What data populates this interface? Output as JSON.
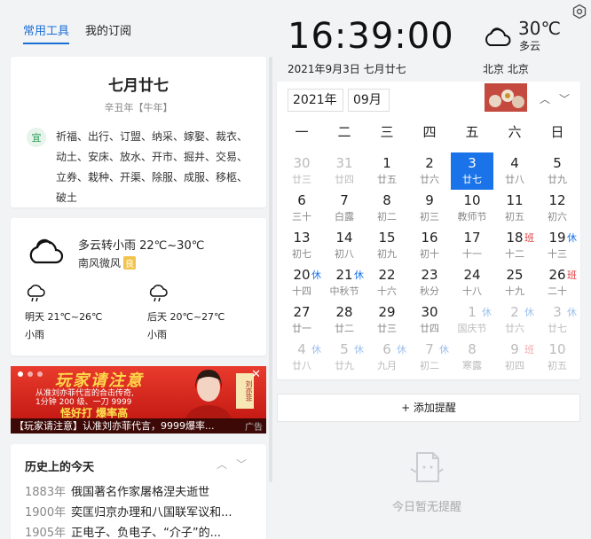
{
  "tabs": [
    {
      "label": "常用工具"
    },
    {
      "label": "我的订阅"
    }
  ],
  "almanac": {
    "lunar_date": "七月廿七",
    "year": "辛丑年【牛年】",
    "yi_label": "宜",
    "yi_text": "祈福、出行、订盟、纳采、嫁娶、裁衣、动土、安床、放水、开市、掘井、交易、立券、栽种、开渠、除服、成服、移柩、破土"
  },
  "weather_card": {
    "desc": "多云转小雨  22℃~30℃",
    "wind": "南风微风",
    "air_quality": "良",
    "forecast": [
      {
        "temp": "明天 21℃~26℃",
        "cond": "小雨"
      },
      {
        "temp": "后天 20℃~27℃",
        "cond": "小雨"
      }
    ]
  },
  "ad": {
    "headline": "玩家请注意",
    "line1": "从准刘亦菲代言的合击传奇,",
    "line2": "1分钟 200 级、一刀 9999",
    "slogan": "怪好打  爆率高",
    "tag": "刘亦菲",
    "caption": "【玩家请注意】认准刘亦菲代言，9999爆率...",
    "label": "广告",
    "close": "✕"
  },
  "history": {
    "title": "历史上的今天",
    "items": [
      {
        "year": "1883年",
        "text": "俄国著名作家屠格涅夫逝世"
      },
      {
        "year": "1900年",
        "text": "奕匡归京办理和八国联军议和..."
      },
      {
        "year": "1905年",
        "text": "正电子、负电子、“介子”的..."
      }
    ]
  },
  "clock": {
    "time": "16:39:00",
    "date": "2021年9月3日  七月廿七"
  },
  "top_weather": {
    "temp": "30℃",
    "desc": "多云",
    "location": "北京 北京",
    "icon": "cloud-icon"
  },
  "calendar": {
    "year": "2021年",
    "month": "09月",
    "weekdays": [
      "一",
      "二",
      "三",
      "四",
      "五",
      "六",
      "日"
    ],
    "days": [
      {
        "n": "30",
        "l": "廿三",
        "other": true
      },
      {
        "n": "31",
        "l": "廿四",
        "other": true
      },
      {
        "n": "1",
        "l": "廿五"
      },
      {
        "n": "2",
        "l": "廿六"
      },
      {
        "n": "3",
        "l": "廿七",
        "today": true
      },
      {
        "n": "4",
        "l": "廿八"
      },
      {
        "n": "5",
        "l": "廿九"
      },
      {
        "n": "6",
        "l": "三十"
      },
      {
        "n": "7",
        "l": "白露"
      },
      {
        "n": "8",
        "l": "初二"
      },
      {
        "n": "9",
        "l": "初三"
      },
      {
        "n": "10",
        "l": "教师节"
      },
      {
        "n": "11",
        "l": "初五"
      },
      {
        "n": "12",
        "l": "初六"
      },
      {
        "n": "13",
        "l": "初七"
      },
      {
        "n": "14",
        "l": "初八"
      },
      {
        "n": "15",
        "l": "初九"
      },
      {
        "n": "16",
        "l": "初十"
      },
      {
        "n": "17",
        "l": "十一"
      },
      {
        "n": "18",
        "l": "十二",
        "badge": "班"
      },
      {
        "n": "19",
        "l": "十三",
        "badge": "休"
      },
      {
        "n": "20",
        "l": "十四",
        "badge": "休"
      },
      {
        "n": "21",
        "l": "中秋节",
        "badge": "休"
      },
      {
        "n": "22",
        "l": "十六"
      },
      {
        "n": "23",
        "l": "秋分"
      },
      {
        "n": "24",
        "l": "十八"
      },
      {
        "n": "25",
        "l": "十九"
      },
      {
        "n": "26",
        "l": "二十",
        "badge": "班"
      },
      {
        "n": "27",
        "l": "廿一"
      },
      {
        "n": "28",
        "l": "廿二"
      },
      {
        "n": "29",
        "l": "廿三"
      },
      {
        "n": "30",
        "l": "廿四"
      },
      {
        "n": "1",
        "l": "国庆节",
        "badge": "休",
        "other": true
      },
      {
        "n": "2",
        "l": "廿六",
        "badge": "休",
        "other": true
      },
      {
        "n": "3",
        "l": "廿七",
        "badge": "休",
        "other": true
      },
      {
        "n": "4",
        "l": "廿八",
        "badge": "休",
        "other": true
      },
      {
        "n": "5",
        "l": "廿九",
        "badge": "休",
        "other": true
      },
      {
        "n": "6",
        "l": "九月",
        "badge": "休",
        "other": true
      },
      {
        "n": "7",
        "l": "初二",
        "badge": "休",
        "other": true
      },
      {
        "n": "8",
        "l": "寒露",
        "other": true
      },
      {
        "n": "9",
        "l": "初四",
        "badge": "班",
        "other": true
      },
      {
        "n": "10",
        "l": "初五",
        "other": true
      }
    ]
  },
  "reminder": {
    "add_label": "+ 添加提醒",
    "empty_text": "今日暂无提醒"
  },
  "colors": {
    "accent": "#1a73e8",
    "holiday": "#1a73e8",
    "workday": "#e0383e"
  }
}
